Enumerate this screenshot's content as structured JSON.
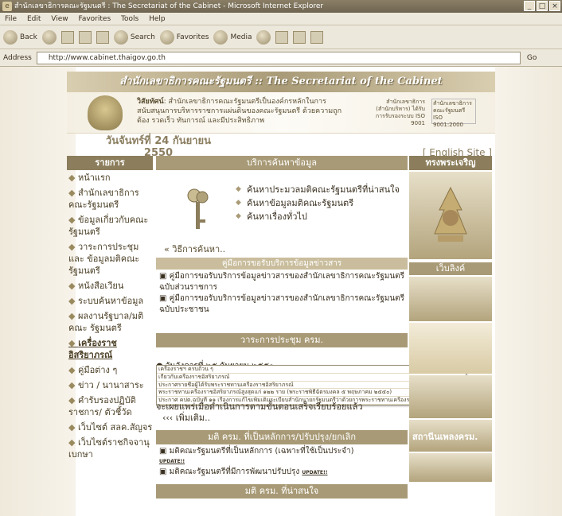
{
  "window": {
    "title": "สำนักเลขาธิการคณะรัฐมนตรี : The Secretariat of the Cabinet - Microsoft Internet Explorer",
    "buttons": [
      "_",
      "□",
      "×"
    ]
  },
  "menubar": [
    "File",
    "Edit",
    "View",
    "Favorites",
    "Tools",
    "Help"
  ],
  "toolbar": {
    "back": "Back",
    "search": "Search",
    "favorites": "Favorites",
    "media": "Media"
  },
  "address": {
    "label": "Address",
    "url": "http://www.cabinet.thaigov.go.th",
    "go": "Go"
  },
  "site": {
    "banner": "สำนักเลขาธิการคณะรัฐมนตรี :: The Secretariat of the Cabinet",
    "vision_label": "วิสัยทัศน์",
    "vision": ": สำนักเลขาธิการคณะรัฐมนตรีเป็นองค์กรหลักในการสนับสนุนการบริหารราชการแผ่นดินของคณะรัฐมนตรี ด้วยความถูกต้อง รวดเร็ว ทันการณ์ และมีประสิทธิภาพ",
    "iso_text": "สำนักเลขาธิการ (สำนักบริหาร) ได้รับการรับรองระบบ ISO 9001",
    "iso_box": "สำนักเลขาธิการคณะรัฐมนตรี ISO 9001:2000",
    "date": "วันจันทร์ที่ 24 กันยายน 2550",
    "english": "[ English Site ]"
  },
  "leftnav": {
    "heading": "รายการ",
    "items": [
      "หน้าแรก",
      "สำนักเลขาธิการคณะรัฐมนตรี",
      "ข้อมูลเกี่ยวกับคณะรัฐมนตรี",
      "วาระการประชุมและ ข้อมูลมติคณะรัฐมนตรี",
      "หนังสือเวียน",
      "ระบบค้นหาข้อมูล",
      "ผลงานรัฐบาล/มติคณะ รัฐมนตรี",
      "เครื่องราชอิสริยาภรณ์",
      "คู่มือต่าง ๆ",
      "ข่าว / นานาสาระ",
      "คำรับรองปฏิบัติราชการ/ ตัวชี้วัด",
      "เว็บไซต์ สลค.สัญจร",
      "เว็บไซต์ราชกิจจานุเบกษา"
    ]
  },
  "center": {
    "service_heading": "บริการค้นหาข้อมูล",
    "search_links": [
      "ค้นหาประมวลมติคณะรัฐมนตรีที่น่าสนใจ",
      "ค้นหาข้อมูลมติคณะรัฐมนตรี",
      "ค้นหาเรื่องทั่วไป"
    ],
    "how_to": "วิธีการค้นหา..",
    "guide_heading": "คู่มือการขอรับบริการข้อมูลข่าวสาร",
    "guide_items": [
      "คู่มือการขอรับบริการข้อมูลข่าวสารของสำนักเลขาธิการคณะรัฐมนตรี ฉบับส่วนราชการ",
      "คู่มือการขอรับบริการข้อมูลข่าวสารของสำนักเลขาธิการคณะรัฐมนตรี ฉบับประชาชน"
    ],
    "meeting_heading": "วาระการประชุม ครม.",
    "meeting_date": "วันอังคารที่ ๒๕ กันยายน ๒๕๕๐",
    "dropdown": [
      "เครื่องราชฯ ครบถ้วน ๆ",
      "เกี่ยวกับเครื่องราชอิสริยาภรณ์",
      "ประกาศรายชื่อผู้ได้รับพระราชทานเครื่องราชอิสริยาภรณ์",
      "พระราชทานเครื่องราชอิสริยาภรณ์สูงสุดแก่ ๑๒๒ ราย (พระราชพิธีฉัตรมงคล ๕ พฤษภาคม ๒๕๕๐)",
      "ประกาศ คปต.ฉบับที่ ๑๑ เรื่องการแก้ไขเพิ่มเติมระเบียบสำนักนายกรัฐมนตรีว่าด้วยการพระราชทานเครื่องราช"
    ],
    "meeting_tail": "จะเผยแพร่เมื่อดำเนินการตามขั้นตอนเสร็จเรียบร้อยแล้ว",
    "more": "เพิ่มเติม..",
    "res_heading": "มติ ครม. ที่เป็นหลักการ/ปรับปรุง/ยกเลิก",
    "res_items": [
      "มติคณะรัฐมนตรีที่เป็นหลักการ (เฉพาะที่ใช้เป็นประจำ)",
      "มติคณะรัฐมนตรีที่มีการพัฒนาปรับปรุง"
    ],
    "update_label": "UPDATE!!",
    "bottom_heading": "มติ ครม. ที่น่าสนใจ"
  },
  "rightcol": {
    "heading": "ทรงพระเจริญ",
    "weblink": "เว็บลิงค์",
    "banner_label": "สถานีนเพลงครม."
  }
}
